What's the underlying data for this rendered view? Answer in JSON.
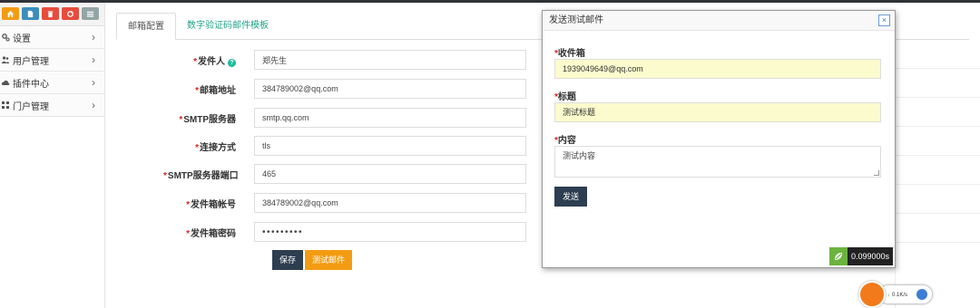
{
  "sidebar": {
    "quick_buttons": [
      {
        "icon": "home-icon",
        "color": "#f39c12"
      },
      {
        "icon": "document-icon",
        "color": "#3c8dbc"
      },
      {
        "icon": "trash-icon",
        "color": "#e74c3c"
      },
      {
        "icon": "refresh-icon",
        "color": "#e74c3c"
      },
      {
        "icon": "list-icon",
        "color": "#95a5a6"
      }
    ],
    "items": [
      {
        "label": "设置",
        "icon": "gears-icon"
      },
      {
        "label": "用户管理",
        "icon": "users-icon"
      },
      {
        "label": "插件中心",
        "icon": "cloud-icon"
      },
      {
        "label": "门户管理",
        "icon": "grid-icon"
      }
    ]
  },
  "tabs": [
    {
      "label": "邮箱配置",
      "active": true
    },
    {
      "label": "数字验证码邮件模板",
      "active": false
    }
  ],
  "form": {
    "sender": {
      "label": "发件人",
      "value": "郑先生"
    },
    "email": {
      "label": "邮箱地址",
      "value": "384789002@qq.com"
    },
    "smtp_server": {
      "label": "SMTP服务器",
      "value": "smtp.qq.com"
    },
    "connection": {
      "label": "连接方式",
      "value": "tls"
    },
    "smtp_port": {
      "label": "SMTP服务器端口",
      "value": "465"
    },
    "account": {
      "label": "发件箱帐号",
      "value": "384789002@qq.com"
    },
    "password": {
      "label": "发件箱密码",
      "value": "•••••••••"
    },
    "save_label": "保存",
    "test_label": "测试邮件"
  },
  "modal": {
    "title": "发送测试邮件",
    "close_glyph": "×",
    "recipient_label": "收件箱",
    "recipient_value": "1939049649@qq.com",
    "subject_label": "标题",
    "subject_value": "测试标题",
    "content_label": "内容",
    "content_value": "测试内容",
    "send_label": "发送",
    "timer_value": "0.099000s"
  },
  "speed_widget": {
    "rate": "0.1K/s"
  },
  "colors": {
    "accent": "#23a38a",
    "dark_button": "#2c3e50",
    "orange_button": "#f39c12",
    "required": "#e02222",
    "autofill": "#fbfbcd"
  }
}
